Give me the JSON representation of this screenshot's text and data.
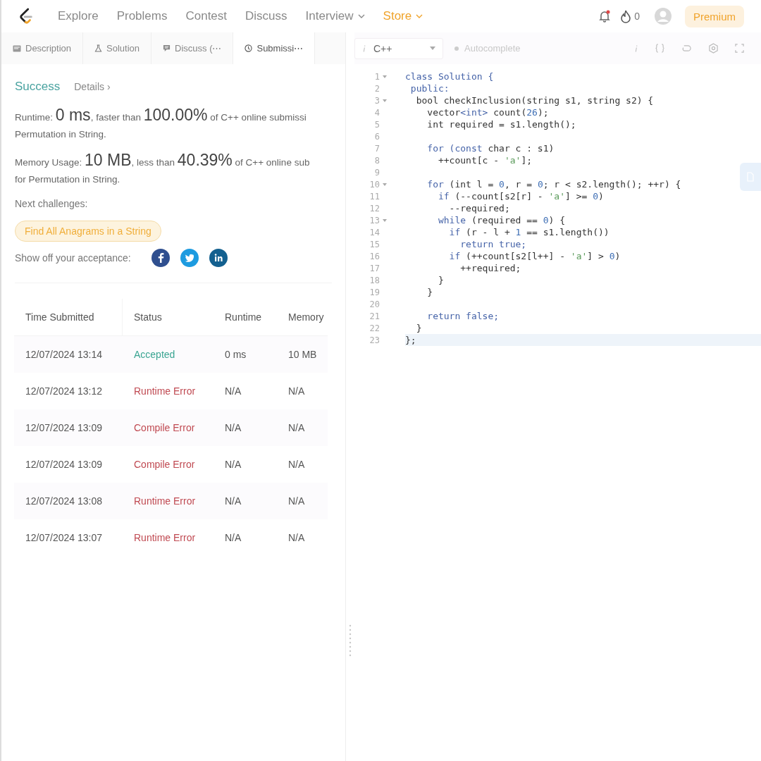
{
  "nav": {
    "items": [
      {
        "label": "Explore",
        "kind": "link"
      },
      {
        "label": "Problems",
        "kind": "link"
      },
      {
        "label": "Contest",
        "kind": "link"
      },
      {
        "label": "Discuss",
        "kind": "link"
      },
      {
        "label": "Interview",
        "kind": "dropdown"
      },
      {
        "label": "Store",
        "kind": "store"
      }
    ],
    "streak_count": "0",
    "premium": "Premium"
  },
  "tabs": [
    {
      "label": "Description",
      "kind": "description",
      "selected": false
    },
    {
      "label": "Solution",
      "kind": "solution",
      "selected": false
    },
    {
      "label": "Discuss (⋯",
      "kind": "discuss",
      "selected": false
    },
    {
      "label": "Submissi⋯",
      "kind": "submissions",
      "selected": true
    }
  ],
  "result": {
    "status": "Success",
    "details": "Details ›",
    "runtime": [
      "Runtime: **0 ms**, faster than **100.00%** of C++ online submissi",
      "Permutation in String."
    ],
    "memory": [
      "Memory Usage: **10 MB**, less than **40.39%** of C++ online sub",
      "for Permutation in String."
    ],
    "next_label": "Next challenges:",
    "next_challenges": [
      "Find All Anagrams in a String"
    ],
    "share_label": "Show off your acceptance:"
  },
  "table": {
    "columns": [
      "Time Submitted",
      "Status",
      "Runtime",
      "Memory"
    ],
    "rows": [
      {
        "time": "12/07/2024 13:14",
        "status": "Accepted",
        "kind": "accepted",
        "runtime": "0 ms",
        "memory": "10 MB"
      },
      {
        "time": "12/07/2024 13:12",
        "status": "Runtime Error",
        "kind": "error",
        "runtime": "N/A",
        "memory": "N/A"
      },
      {
        "time": "12/07/2024 13:09",
        "status": "Compile Error",
        "kind": "error",
        "runtime": "N/A",
        "memory": "N/A"
      },
      {
        "time": "12/07/2024 13:09",
        "status": "Compile Error",
        "kind": "error",
        "runtime": "N/A",
        "memory": "N/A"
      },
      {
        "time": "12/07/2024 13:08",
        "status": "Runtime Error",
        "kind": "error",
        "runtime": "N/A",
        "memory": "N/A"
      },
      {
        "time": "12/07/2024 13:07",
        "status": "Runtime Error",
        "kind": "error",
        "runtime": "N/A",
        "memory": "N/A"
      }
    ]
  },
  "editor": {
    "language": "C++",
    "autocomplete": {
      "label": "Autocomplete",
      "on": false
    },
    "lines": [
      {
        "n": "1",
        "fold": true,
        "active": false,
        "tokens": [
          {
            "text": "class Solution {",
            "kind": "keyword"
          }
        ]
      },
      {
        "n": "2",
        "fold": false,
        "active": false,
        "tokens": [
          {
            "text": " public:",
            "kind": "keyword"
          }
        ]
      },
      {
        "n": "3",
        "fold": true,
        "active": false,
        "tokens": [
          {
            "text": "  bool checkInclusion(string s1, string s2) {",
            "kind": "plain"
          }
        ]
      },
      {
        "n": "4",
        "fold": false,
        "active": false,
        "tokens": [
          {
            "text": "    vector",
            "kind": "plain"
          },
          {
            "text": "<int>",
            "kind": "keyword"
          },
          {
            "text": " count(",
            "kind": "plain"
          },
          {
            "text": "26",
            "kind": "number"
          },
          {
            "text": ");",
            "kind": "plain"
          }
        ]
      },
      {
        "n": "5",
        "fold": false,
        "active": false,
        "tokens": [
          {
            "text": "    int required = s1.length();",
            "kind": "plain"
          }
        ]
      },
      {
        "n": "6",
        "fold": false,
        "active": false
      },
      {
        "n": "7",
        "fold": false,
        "active": false,
        "tokens": [
          {
            "text": "    for (const",
            "kind": "keyword"
          },
          {
            "text": " char c : s1)",
            "kind": "plain"
          }
        ]
      },
      {
        "n": "8",
        "fold": false,
        "active": false,
        "tokens": [
          {
            "text": "      ++count[c - ",
            "kind": "plain"
          },
          {
            "text": "'a'",
            "kind": "string"
          },
          {
            "text": "];",
            "kind": "plain"
          }
        ]
      },
      {
        "n": "9",
        "fold": false,
        "active": false
      },
      {
        "n": "10",
        "fold": true,
        "active": false,
        "tokens": [
          {
            "text": "    for",
            "kind": "keyword"
          },
          {
            "text": " (int l = ",
            "kind": "plain"
          },
          {
            "text": "0",
            "kind": "number"
          },
          {
            "text": ", r = ",
            "kind": "plain"
          },
          {
            "text": "0",
            "kind": "number"
          },
          {
            "text": "; r < s2.length(); ++r) {",
            "kind": "plain"
          }
        ]
      },
      {
        "n": "11",
        "fold": false,
        "active": false,
        "tokens": [
          {
            "text": "      if",
            "kind": "keyword"
          },
          {
            "text": " (--count[s2[r] - ",
            "kind": "plain"
          },
          {
            "text": "'a'",
            "kind": "string"
          },
          {
            "text": "] >= ",
            "kind": "plain"
          },
          {
            "text": "0",
            "kind": "number"
          },
          {
            "text": ")",
            "kind": "plain"
          }
        ]
      },
      {
        "n": "12",
        "fold": false,
        "active": false,
        "tokens": [
          {
            "text": "        --required;",
            "kind": "plain"
          }
        ]
      },
      {
        "n": "13",
        "fold": true,
        "active": false,
        "tokens": [
          {
            "text": "      while",
            "kind": "keyword"
          },
          {
            "text": " (required == ",
            "kind": "plain"
          },
          {
            "text": "0",
            "kind": "number"
          },
          {
            "text": ") {",
            "kind": "plain"
          }
        ]
      },
      {
        "n": "14",
        "fold": false,
        "active": false,
        "tokens": [
          {
            "text": "        if",
            "kind": "keyword"
          },
          {
            "text": " (r - l + ",
            "kind": "plain"
          },
          {
            "text": "1",
            "kind": "number"
          },
          {
            "text": " == s1.length())",
            "kind": "plain"
          }
        ]
      },
      {
        "n": "15",
        "fold": false,
        "active": false,
        "tokens": [
          {
            "text": "          return true;",
            "kind": "keyword"
          }
        ]
      },
      {
        "n": "16",
        "fold": false,
        "active": false,
        "tokens": [
          {
            "text": "        if",
            "kind": "keyword"
          },
          {
            "text": " (++count[s2[l++] - ",
            "kind": "plain"
          },
          {
            "text": "'a'",
            "kind": "string"
          },
          {
            "text": "] > ",
            "kind": "plain"
          },
          {
            "text": "0",
            "kind": "number"
          },
          {
            "text": ")",
            "kind": "plain"
          }
        ]
      },
      {
        "n": "17",
        "fold": false,
        "active": false,
        "tokens": [
          {
            "text": "          ++required;",
            "kind": "plain"
          }
        ]
      },
      {
        "n": "18",
        "fold": false,
        "active": false,
        "tokens": [
          {
            "text": "      }",
            "kind": "plain"
          }
        ]
      },
      {
        "n": "19",
        "fold": false,
        "active": false,
        "tokens": [
          {
            "text": "    }",
            "kind": "plain"
          }
        ]
      },
      {
        "n": "20",
        "fold": false,
        "active": false
      },
      {
        "n": "21",
        "fold": false,
        "active": false,
        "tokens": [
          {
            "text": "    return false;",
            "kind": "keyword"
          }
        ]
      },
      {
        "n": "22",
        "fold": false,
        "active": false,
        "tokens": [
          {
            "text": "  }",
            "kind": "plain"
          }
        ]
      },
      {
        "n": "23",
        "fold": false,
        "active": true,
        "tokens": [
          {
            "text": "};",
            "kind": "plain"
          }
        ]
      }
    ]
  }
}
